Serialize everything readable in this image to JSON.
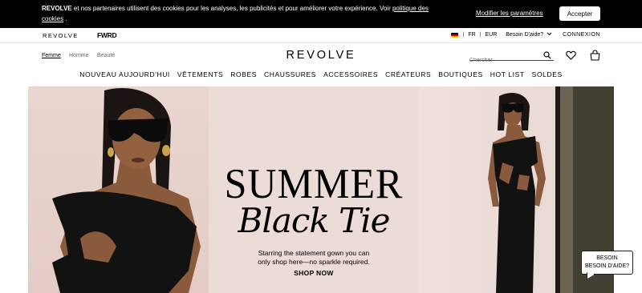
{
  "cookie_banner": {
    "brand": "REVOLVE",
    "text": " et nos partenaires utilisent des cookies pour les analyses, les publicités et pour améliorer votre expérience.  Voir ",
    "policy_link": "politique des cookies",
    "after_link": " .",
    "modify_label": "Modifier les paramètres",
    "accept_label": "Accepter"
  },
  "utility_bar": {
    "revolve_label": "REVOLVE",
    "fwrd_label": "FWRD",
    "language": "FR",
    "separator": "|",
    "currency": "EUR",
    "help_label": "Besoin D'aide?",
    "login_label": "CONNEXION"
  },
  "header": {
    "categories": [
      "Femme",
      "Homme",
      "Beauté"
    ],
    "logo": "REVOLVE",
    "search_placeholder": "Chercher"
  },
  "nav": {
    "items": [
      "NOUVEAU AUJOURD'HUI",
      "VÊTEMENTS",
      "ROBES",
      "CHAUSSURES",
      "ACCESSOIRES",
      "CRÉATEURS",
      "BOUTIQUES",
      "HOT LIST",
      "SOLDES"
    ]
  },
  "hero": {
    "title": "SUMMER",
    "subtitle": "Black Tie",
    "description_line1": "Starring the statement gown you can",
    "description_line2": "only shop here—no sparkle required.",
    "cta": "SHOP NOW"
  },
  "help_bubble": {
    "line1": "BESOIN",
    "line2": "BESOIN D'AIDE?"
  },
  "colors": {
    "banner_bg": "#000000",
    "hero_bg": "#ecdcd8",
    "dress": "#121212",
    "skin": "#8a5a3d"
  },
  "icons": {
    "search": "search-icon",
    "heart": "heart-icon",
    "bag": "shopping-bag-icon",
    "chevron": "chevron-down-icon",
    "flag": "germany-flag-icon"
  }
}
